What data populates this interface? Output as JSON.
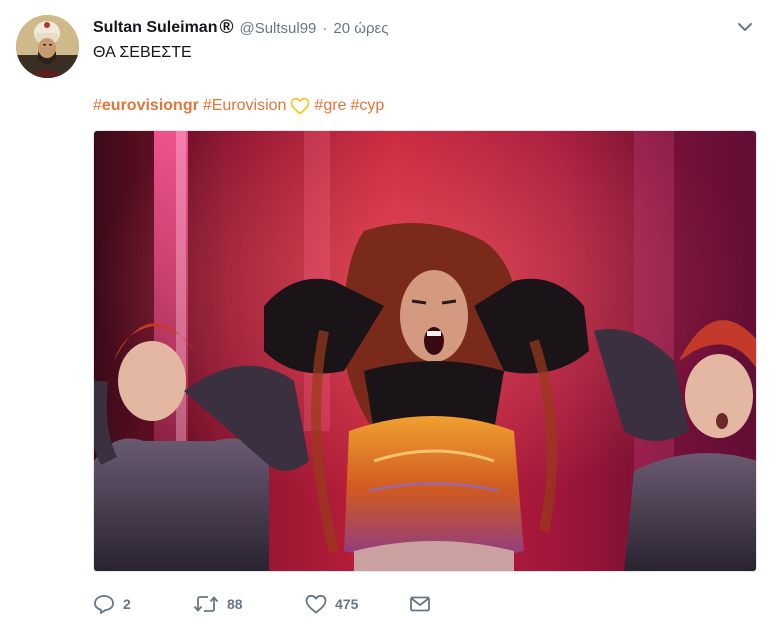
{
  "tweet": {
    "author": {
      "display_name": "Sultan Suleiman",
      "badge_glyph": "®",
      "handle": "@Sultsul99",
      "separator": "·",
      "time": "20 ώρες",
      "avatar_icon": "avatar-sultan-portrait"
    },
    "text": "ΘΑ ΣΕΒΕΣΤΕ",
    "hashtags": [
      {
        "hash": "#",
        "label": "eurovisiongr"
      },
      {
        "hash": "#",
        "label": "Eurovision"
      },
      {
        "hash": "#",
        "label": "gre"
      },
      {
        "hash": "#",
        "label": "cyp"
      }
    ],
    "emoji": "yellow-heart-icon",
    "media": {
      "kind": "photo",
      "subject": "stage-performance-photo"
    },
    "actions": {
      "reply": {
        "icon": "reply-icon",
        "count": "2"
      },
      "retweet": {
        "icon": "retweet-icon",
        "count": "88"
      },
      "like": {
        "icon": "heart-icon",
        "count": "475"
      },
      "message": {
        "icon": "direct-message-icon"
      }
    },
    "menu_icon": "chevron-down-icon"
  },
  "colors": {
    "hashtag": "#e0763a",
    "secondary_text": "#657786",
    "primary_text": "#14171a",
    "heart_emoji": "#f5c518"
  }
}
